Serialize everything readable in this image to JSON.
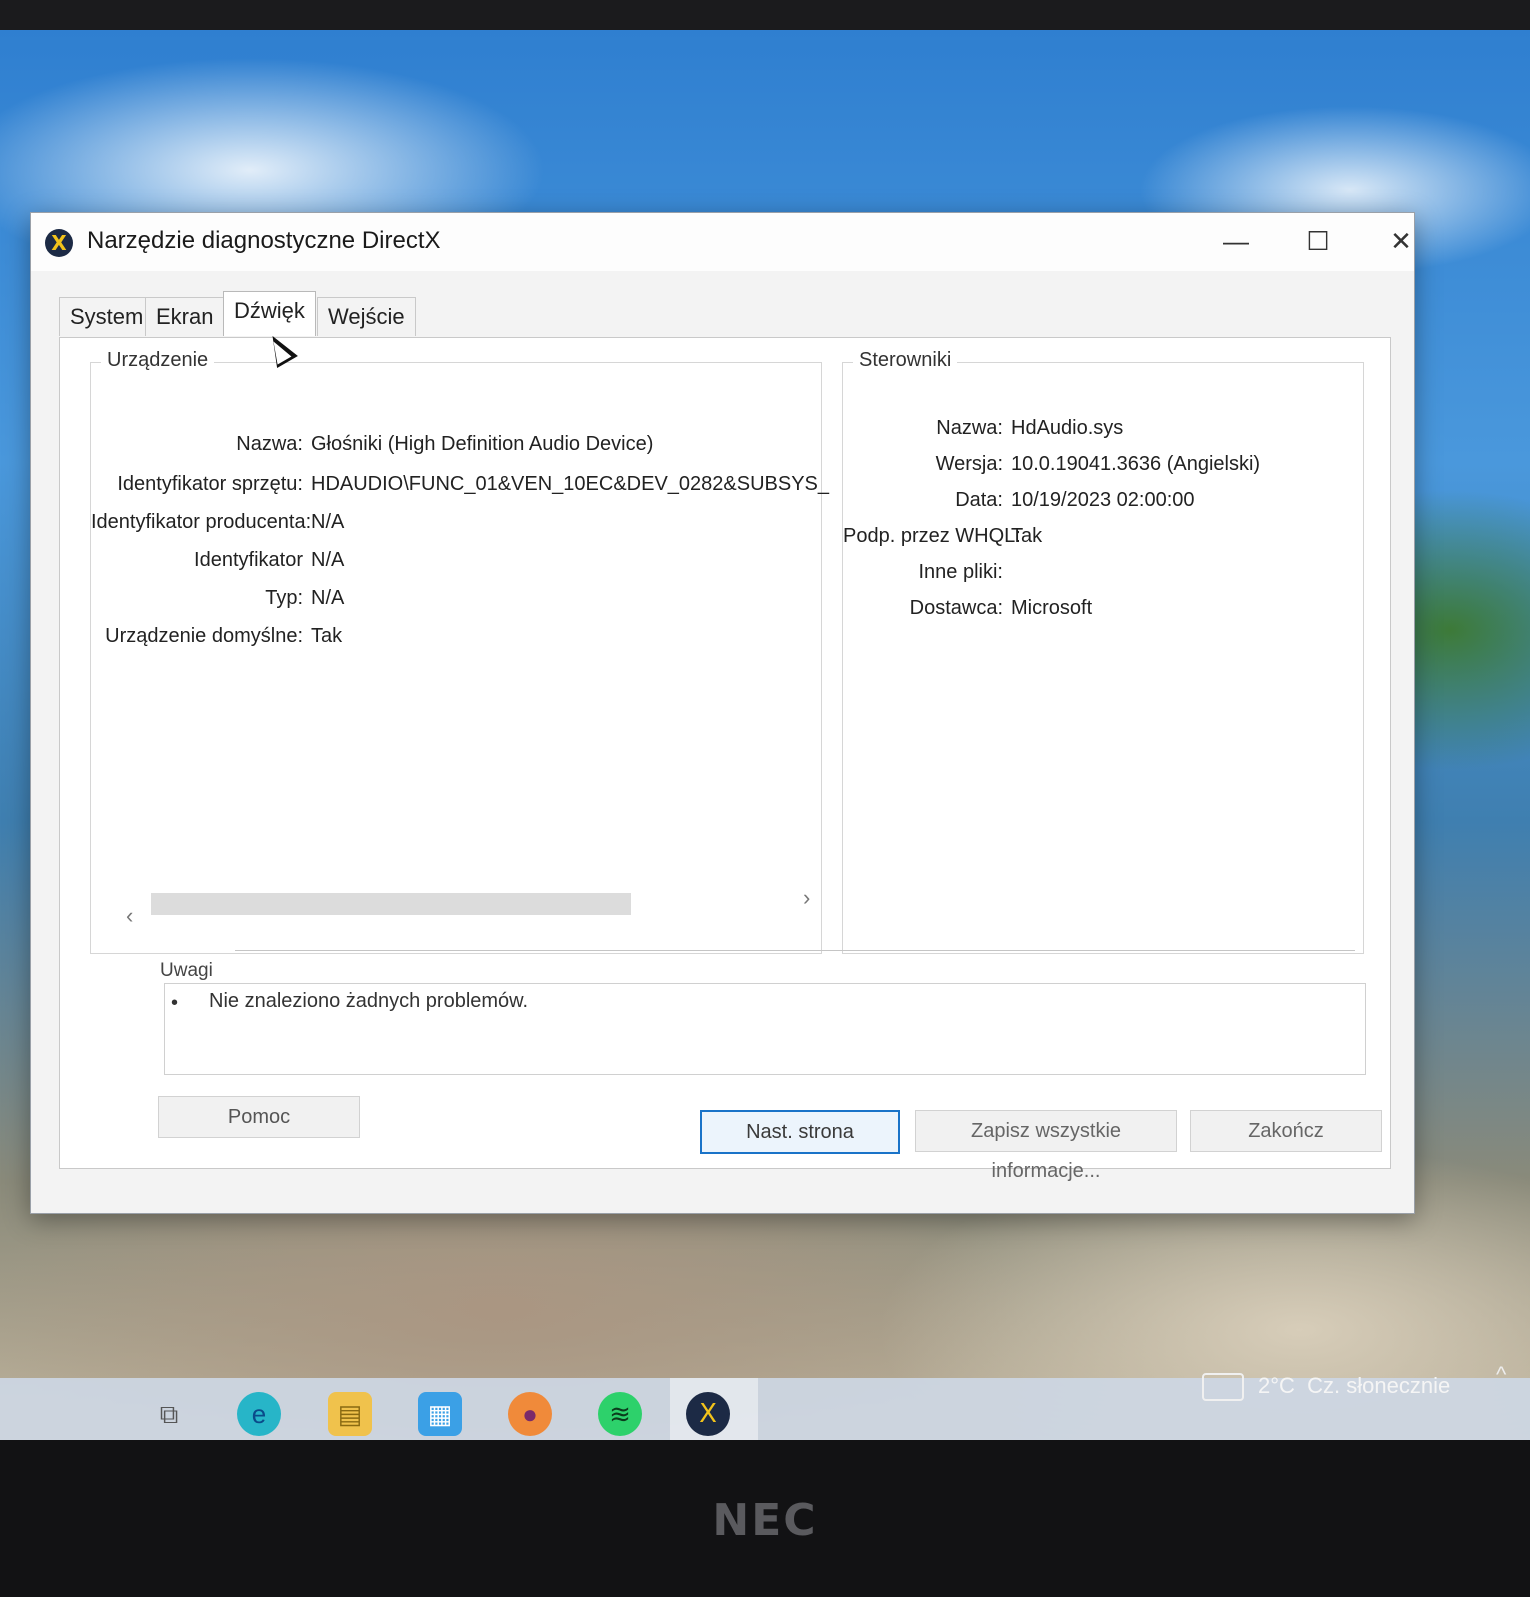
{
  "window": {
    "title": "Narzędzie diagnostyczne DirectX",
    "controls": {
      "minimize": "—",
      "maximize": "☐",
      "close": "✕"
    }
  },
  "tabs": [
    {
      "label": "System",
      "active": false
    },
    {
      "label": "Ekran",
      "active": false
    },
    {
      "label": "Dźwięk",
      "active": true
    },
    {
      "label": "Wejście",
      "active": false
    }
  ],
  "device": {
    "group_label": "Urządzenie",
    "fields": [
      {
        "label": "Nazwa:",
        "value": "Głośniki (High Definition Audio Device)"
      },
      {
        "label": "Identyfikator sprzętu:",
        "value": "HDAUDIO\\FUNC_01&VEN_10EC&DEV_0282&SUBSYS_"
      },
      {
        "label": "Identyfikator producenta:",
        "value": "N/A"
      },
      {
        "label": "Identyfikator",
        "value": "N/A"
      },
      {
        "label": "Typ:",
        "value": "N/A"
      },
      {
        "label": "Urządzenie domyślne:",
        "value": "Tak"
      }
    ]
  },
  "drivers": {
    "group_label": "Sterowniki",
    "fields": [
      {
        "label": "Nazwa:",
        "value": "HdAudio.sys"
      },
      {
        "label": "Wersja:",
        "value": "10.0.19041.3636 (Angielski)"
      },
      {
        "label": "Data:",
        "value": "10/19/2023 02:00:00"
      },
      {
        "label": "Podp. przez WHQL:",
        "value": "Tak"
      },
      {
        "label": "Inne pliki:",
        "value": ""
      },
      {
        "label": "Dostawca:",
        "value": "Microsoft"
      }
    ]
  },
  "notes": {
    "label": "Uwagi",
    "items": [
      "Nie znaleziono żadnych problemów."
    ]
  },
  "buttons": {
    "help": "Pomoc",
    "next": "Nast. strona",
    "save": "Zapisz wszystkie informacje...",
    "exit": "Zakończ"
  },
  "taskbar": {
    "weather_temp": "2°C",
    "weather_text": "Cz. słonecznie",
    "icons": [
      "task-view-icon",
      "edge-icon",
      "file-explorer-icon",
      "store-icon",
      "firefox-icon",
      "spotify-icon",
      "dxdiag-icon"
    ]
  },
  "monitor": {
    "brand": "NEC"
  },
  "colors": {
    "accent": "#1a73c8",
    "dx_icon_bg": "#1c2a45",
    "dx_icon_fg": "#f2c31b"
  }
}
